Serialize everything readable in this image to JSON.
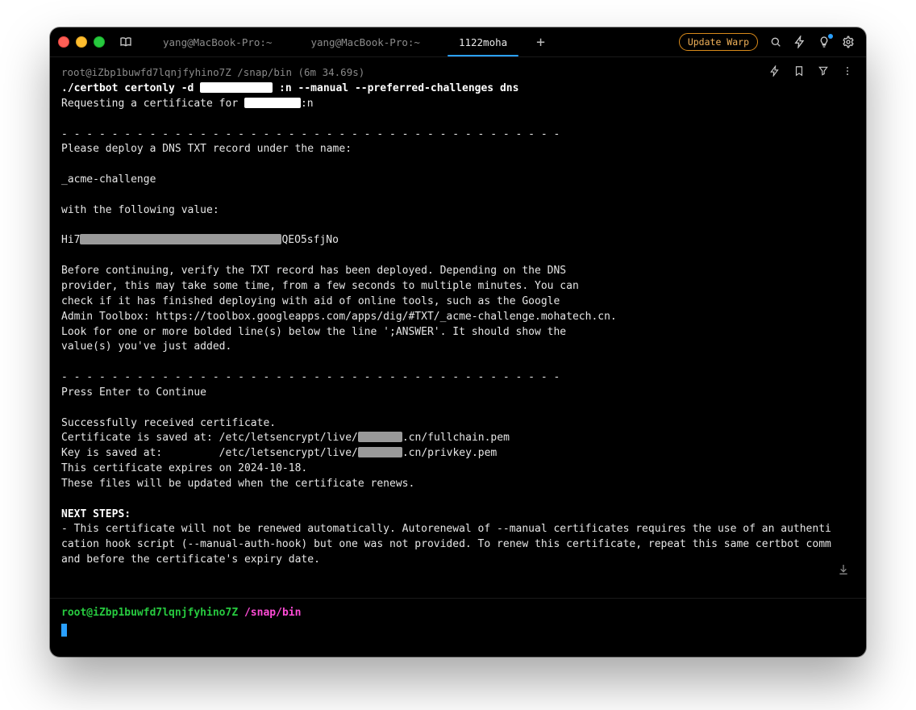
{
  "titlebar": {
    "tabs": [
      {
        "label": "yang@MacBook-Pro:~"
      },
      {
        "label": "yang@MacBook-Pro:~"
      },
      {
        "label": "1122moha",
        "active": true
      }
    ],
    "new_tab_glyph": "+",
    "update_label": "Update Warp"
  },
  "subheader": {
    "path": "root@iZbp1buwfd7lqnjfyhino7Z /snap/bin (6m 34.69s)"
  },
  "terminal": {
    "cmd_prefix": "./certbot certonly -d",
    "cmd_mid": ":n --manual --preferred-challenges dns",
    "requesting_prefix": "Requesting a certificate for ",
    "requesting_suffix": ":n",
    "dash_sep": "- - - - - - - - - - - - - - - - - - - - - - - - - - - - - - - - - - - - - - - -",
    "deploy_line": "Please deploy a DNS TXT record under the name:",
    "acme_label": "_acme-challenge",
    "value_intro": "with the following value:",
    "value_prefix": "Hi7",
    "value_suffix": "QEO5sfjNo",
    "verify_block": "Before continuing, verify the TXT record has been deployed. Depending on the DNS\nprovider, this may take some time, from a few seconds to multiple minutes. You can\ncheck if it has finished deploying with aid of online tools, such as the Google\nAdmin Toolbox: https://toolbox.googleapps.com/apps/dig/#TXT/_acme-challenge.mohatech.cn.\nLook for one or more bolded line(s) below the line ';ANSWER'. It should show the\nvalue(s) you've just added.",
    "press_enter": "Press Enter to Continue",
    "success_line": "Successfully received certificate.",
    "cert_saved_prefix": "Certificate is saved at: /etc/letsencrypt/live/",
    "cert_saved_suffix": ".cn/fullchain.pem",
    "key_saved_prefix": "Key is saved at:         /etc/letsencrypt/live/",
    "key_saved_suffix": ".cn/privkey.pem",
    "expiry_line": "This certificate expires on 2024-10-18.",
    "renew_files_line": "These files will be updated when the certificate renews.",
    "next_steps_heading": "NEXT STEPS:",
    "next_steps_body": "- This certificate will not be renewed automatically. Autorenewal of --manual certificates requires the use of an authenti\ncation hook script (--manual-auth-hook) but one was not provided. To renew this certificate, repeat this same certbot comm\nand before the certificate's expiry date."
  },
  "prompt": {
    "user": "root@iZbp1buwfd7lqnjfyhino7Z",
    "path": "/snap/bin"
  }
}
